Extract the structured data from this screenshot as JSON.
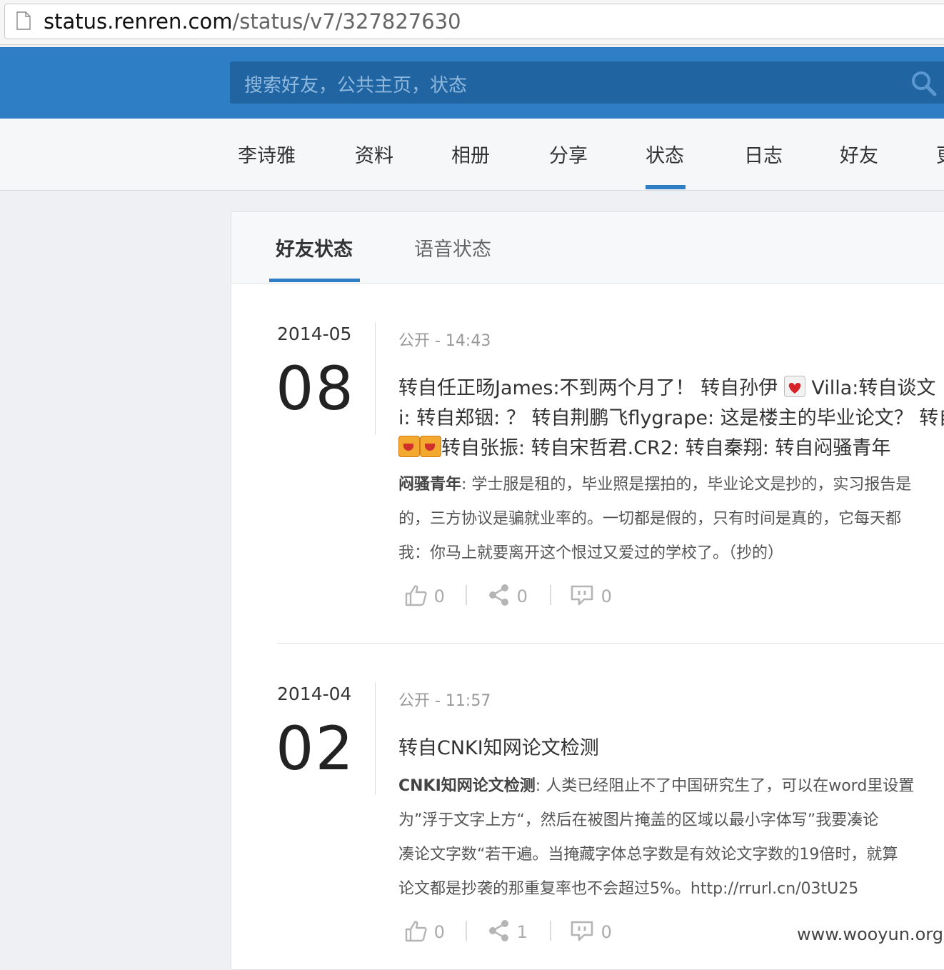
{
  "browser": {
    "url_host": "status.renren.com",
    "url_path": "/status/v7/327827630"
  },
  "header": {
    "search_placeholder": "搜索好友，公共主页，状态"
  },
  "nav": {
    "items": [
      "李诗雅",
      "资料",
      "相册",
      "分享",
      "状态",
      "日志",
      "好友",
      "更"
    ],
    "active": "状态"
  },
  "tabs": {
    "items": [
      "好友状态",
      "语音状态"
    ],
    "active": "好友状态"
  },
  "entries": [
    {
      "year_month": "2014-05",
      "day": "08",
      "meta": "公开 - 14:43",
      "title_lines": [
        [
          "转自任正旸James:不到两个月了！  转自孙伊",
          "Villa:转自谈文"
        ],
        [
          "i: 转自郑铟: ？ 转自荆鹏飞flygrape: 这是楼主的毕业论文？ 转自"
        ],
        [
          "转自张振: 转自宋哲君.CR2: 转自秦翔: 转自闷骚青年"
        ]
      ],
      "body_author": "闷骚青年",
      "body_lines": [
        ": 学士服是租的，毕业照是摆拍的，毕业论文是抄的，实习报告是",
        "的，三方协议是骗就业率的。一切都是假的，只有时间是真的，它每天都",
        "我：你马上就要离开这个恨过又爱过的学校了。（抄的）"
      ],
      "likes": "0",
      "shares": "0",
      "comments": "0"
    },
    {
      "year_month": "2014-04",
      "day": "02",
      "meta": "公开 - 11:57",
      "title": "转自CNKI知网论文检测",
      "body_author": "CNKI知网论文检测",
      "body_lines": [
        ": 人类已经阻止不了中国研究生了，可以在word里设置",
        "为”浮于文字上方“，然后在被图片掩盖的区域以最小字体写”我要凑论",
        "凑论文字数“若干遍。当掩藏字体总字数是有效论文字数的19倍时，就算",
        "论文都是抄袭的那重复率也不会超过5%。http://rrurl.cn/03tU25"
      ],
      "likes": "0",
      "shares": "1",
      "comments": "0"
    }
  ],
  "watermark": "www.wooyun.org",
  "colors": {
    "brand_blue": "#2e7ec6",
    "search_bg": "#2064a2"
  }
}
